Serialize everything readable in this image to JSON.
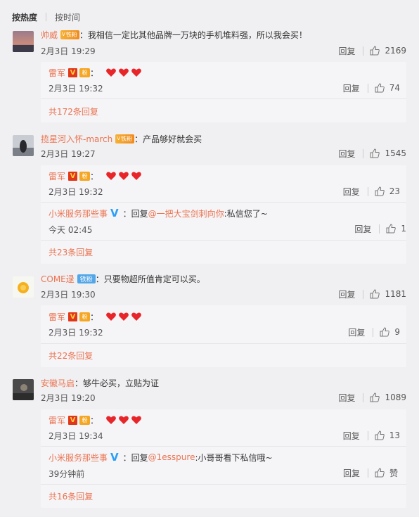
{
  "tabs": {
    "hot": "按热度",
    "time": "按时间"
  },
  "labels": {
    "reply": "回复",
    "like_empty": "赞",
    "colon": "："
  },
  "colors": {
    "accent": "#eb7350",
    "badge_gold": "#f5a623",
    "verified_blue": "#2b9ff6",
    "verified_red": "#e2361b",
    "heart": "#e8262a"
  },
  "comments": [
    {
      "user": "帅威",
      "badge": "铁粉",
      "text": "我相信一定比其他品牌一万块的手机堆料强，所以我会买！",
      "date": "2月3日 19:29",
      "likes": "2169",
      "replies": [
        {
          "user": "雷军",
          "verified": "V",
          "fan_badge": "粉",
          "date": "2月3日 19:32",
          "likes": "74"
        }
      ],
      "more": "共172条回复"
    },
    {
      "user": "揽星河入怀-march",
      "badge": "铁粉",
      "text": "产品够好就会买",
      "date": "2月3日 19:27",
      "likes": "1545",
      "replies": [
        {
          "user": "雷军",
          "verified": "V",
          "fan_badge": "粉",
          "date": "2月3日 19:32",
          "likes": "23"
        },
        {
          "user": "小米服务那些事",
          "verified": "V",
          "reply_prefix": "回复",
          "mention": "@一把大宝剑刺向你",
          "text": ":私信您了~",
          "date": "今天 02:45",
          "likes": "1"
        }
      ],
      "more": "共23条回复"
    },
    {
      "user": "COME逯",
      "badge": "铁粉",
      "text": "只要物超所值肯定可以买。",
      "date": "2月3日 19:30",
      "likes": "1181",
      "replies": [
        {
          "user": "雷军",
          "verified": "V",
          "fan_badge": "粉",
          "date": "2月3日 19:32",
          "likes": "9"
        }
      ],
      "more": "共22条回复"
    },
    {
      "user": "安徽马启",
      "text": "够牛必买，立贴为证",
      "date": "2月3日 19:20",
      "likes": "1089",
      "replies": [
        {
          "user": "雷军",
          "verified": "V",
          "fan_badge": "粉",
          "date": "2月3日 19:34",
          "likes": "13"
        },
        {
          "user": "小米服务那些事",
          "verified": "V",
          "reply_prefix": "回复",
          "mention": "@1esspure",
          "text": ":小哥哥看下私信哦~",
          "date": "39分钟前",
          "likes": "赞"
        }
      ],
      "more": "共16条回复"
    }
  ]
}
